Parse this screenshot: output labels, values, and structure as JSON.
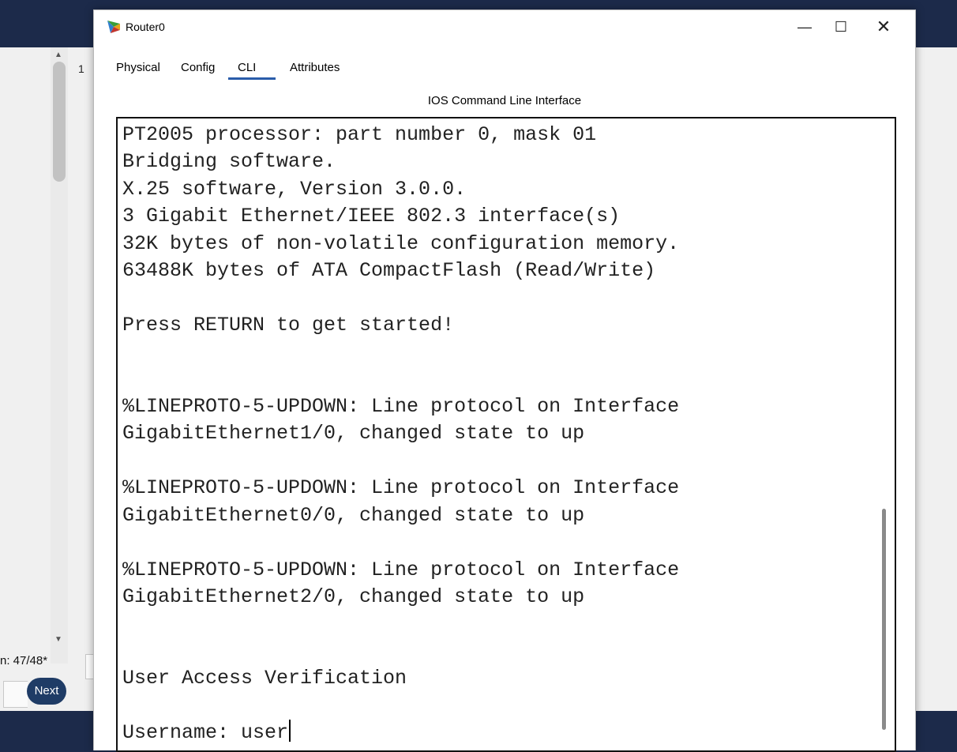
{
  "background_app": {
    "step_number": "1",
    "counter_text": "n: 47/48*",
    "next_label": "Next"
  },
  "window": {
    "title": "Router0",
    "icon": "router-icon",
    "controls": {
      "minimize": "—",
      "maximize": "☐",
      "close": "✕"
    }
  },
  "tabs": [
    {
      "label": "Physical",
      "selected": false
    },
    {
      "label": "Config",
      "selected": false
    },
    {
      "label": "CLI",
      "selected": true
    },
    {
      "label": "Attributes",
      "selected": false
    }
  ],
  "cli": {
    "section_title": "IOS Command Line Interface",
    "output_lines": [
      "PT2005 processor: part number 0, mask 01",
      "Bridging software.",
      "X.25 software, Version 3.0.0.",
      "3 Gigabit Ethernet/IEEE 802.3 interface(s)",
      "32K bytes of non-volatile configuration memory.",
      "63488K bytes of ATA CompactFlash (Read/Write)",
      "",
      "Press RETURN to get started!",
      "",
      "",
      "%LINEPROTO-5-UPDOWN: Line protocol on Interface",
      "GigabitEthernet1/0, changed state to up",
      "",
      "%LINEPROTO-5-UPDOWN: Line protocol on Interface",
      "GigabitEthernet0/0, changed state to up",
      "",
      "%LINEPROTO-5-UPDOWN: Line protocol on Interface",
      "GigabitEthernet2/0, changed state to up",
      "",
      "",
      "User Access Verification",
      ""
    ],
    "prompt": "Username: ",
    "input_value": "user"
  }
}
